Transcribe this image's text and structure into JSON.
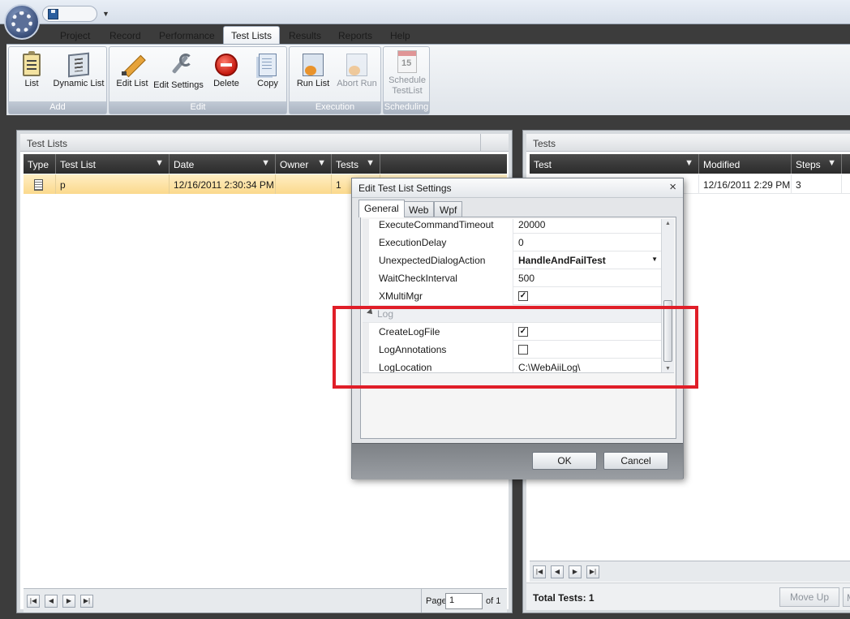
{
  "window": {
    "quick_access": "save-icon"
  },
  "ribbon": {
    "tabs": [
      "Project",
      "Record",
      "Performance",
      "Test Lists",
      "Results",
      "Reports",
      "Help"
    ],
    "active_tab": "Test Lists",
    "groups": [
      {
        "caption": "Add",
        "buttons": [
          {
            "label": "List",
            "icon": "clipboard-list-icon"
          },
          {
            "label": "Dynamic List",
            "icon": "dynamic-list-icon"
          }
        ]
      },
      {
        "caption": "Edit",
        "buttons": [
          {
            "label": "Edit List",
            "icon": "pencil-icon"
          },
          {
            "label": "Edit Settings",
            "icon": "wrench-icon"
          },
          {
            "label": "Delete",
            "icon": "delete-icon"
          },
          {
            "label": "Copy",
            "icon": "copy-icon"
          }
        ]
      },
      {
        "caption": "Execution",
        "buttons": [
          {
            "label": "Run List",
            "icon": "run-list-icon"
          },
          {
            "label": "Abort Run",
            "icon": "abort-run-icon",
            "disabled": true
          }
        ]
      },
      {
        "caption": "Scheduling",
        "buttons": [
          {
            "label": "Schedule TestList",
            "label_lines": [
              "Schedule",
              "TestList"
            ],
            "icon": "calendar-icon",
            "disabled": true
          }
        ]
      }
    ]
  },
  "test_lists_panel": {
    "title": "Test Lists",
    "columns": [
      "Type",
      "Test List",
      "Date",
      "Owner",
      "Tests"
    ],
    "rows": [
      {
        "type_icon": "list-icon",
        "test_list": "p",
        "date": "12/16/2011 2:30:34 PM",
        "owner": "",
        "tests": "1"
      }
    ],
    "pager": {
      "page_label": "Page",
      "page_value": "1",
      "of_label": "of 1"
    }
  },
  "tests_panel": {
    "title": "Tests",
    "columns": [
      "Test",
      "Modified",
      "Steps"
    ],
    "rows": [
      {
        "test": "",
        "modified": "12/16/2011 2:29 PM",
        "steps": "3"
      }
    ],
    "total_label": "Total Tests: 1",
    "move_up_label": "Move Up",
    "move_down_label": "M"
  },
  "dialog": {
    "title": "Edit Test List Settings",
    "tabs": [
      "General",
      "Web",
      "Wpf"
    ],
    "active_tab": "General",
    "properties": [
      {
        "name": "ExecuteCommandTimeout",
        "value": "20000"
      },
      {
        "name": "ExecutionDelay",
        "value": "0"
      },
      {
        "name": "UnexpectedDialogAction",
        "value": "HandleAndFailTest",
        "dropdown": true
      },
      {
        "name": "WaitCheckInterval",
        "value": "500"
      },
      {
        "name": "XMultiMgr",
        "checked": true
      },
      {
        "category": "Log"
      },
      {
        "name": "CreateLogFile",
        "checked": true
      },
      {
        "name": "LogAnnotations",
        "checked": false
      },
      {
        "name": "LogLocation",
        "value": "C:\\WebAiiLog\\"
      }
    ],
    "ok_label": "OK",
    "cancel_label": "Cancel"
  },
  "highlight_color": "#e01e28"
}
